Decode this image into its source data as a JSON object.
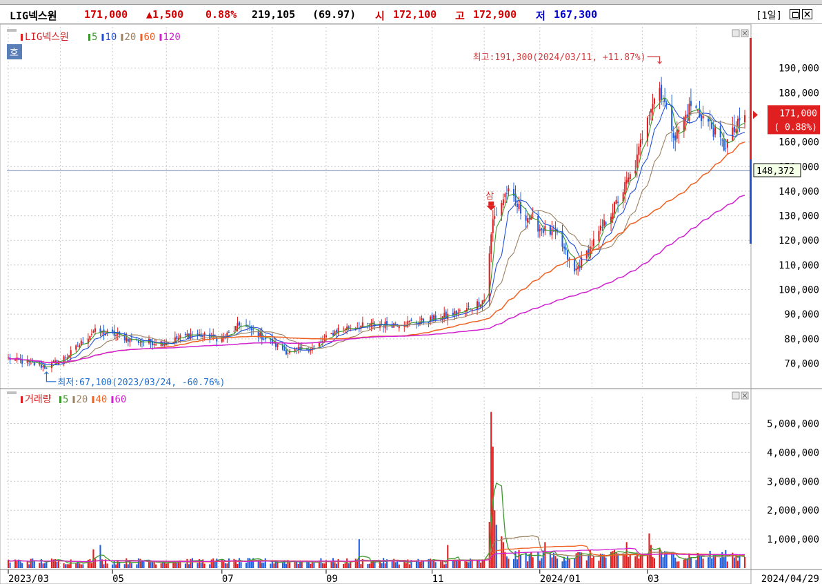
{
  "header": {
    "name": "LIG넥스원",
    "price": "171,000",
    "change": "▲1,500",
    "change_pct": "0.88%",
    "volume": "219,105",
    "volume_ratio": "(69.97)",
    "open_label": "시",
    "open": "172,100",
    "high_label": "고",
    "high": "172,900",
    "low_label": "저",
    "low": "167,300",
    "period": "[1일]"
  },
  "legend_price": {
    "name": "LIG넥스원",
    "ma": [
      {
        "label": "5",
        "color": "#3a9a2a"
      },
      {
        "label": "10",
        "color": "#1f4fd8"
      },
      {
        "label": "20",
        "color": "#9c8060"
      },
      {
        "label": "60",
        "color": "#f06020"
      },
      {
        "label": "120",
        "color": "#d020d0"
      }
    ]
  },
  "legend_volume": {
    "name": "거래량",
    "ma": [
      {
        "label": "5",
        "color": "#3a9a2a"
      },
      {
        "label": "20",
        "color": "#9c8060"
      },
      {
        "label": "40",
        "color": "#f06020"
      },
      {
        "label": "60",
        "color": "#d020d0"
      }
    ]
  },
  "badge": "호",
  "sell_marker": "삼",
  "chart_data": {
    "type": "candlestick",
    "x_start": "2023/03",
    "x_end": "2024/04/29",
    "x_ticks": [
      "2023/03",
      "05",
      "07",
      "09",
      "11",
      "2024/01",
      "03",
      "2024/04/29"
    ],
    "price_axis": {
      "ylim": [
        62000,
        200000
      ],
      "ticks": [
        "70,000",
        "80,000",
        "90,000",
        "100,000",
        "110,000",
        "120,000",
        "130,000",
        "140,000",
        "150,000",
        "160,000",
        "170,000",
        "180,000",
        "190,000"
      ],
      "tick_values": [
        70000,
        80000,
        90000,
        100000,
        110000,
        120000,
        130000,
        140000,
        150000,
        160000,
        170000,
        180000,
        190000
      ]
    },
    "volume_axis": {
      "ylim": [
        0,
        5800000
      ],
      "ticks": [
        "1,000,000",
        "2,000,000",
        "3,000,000",
        "4,000,000",
        "5,000,000"
      ],
      "tick_values": [
        1000000,
        2000000,
        3000000,
        4000000,
        5000000
      ]
    },
    "price_anchors": [
      [
        "2023-03-02",
        72000
      ],
      [
        "2023-03-24",
        68500
      ],
      [
        "2023-04-05",
        73000
      ],
      [
        "2023-04-20",
        83000
      ],
      [
        "2023-05-01",
        82000
      ],
      [
        "2023-05-15",
        79000
      ],
      [
        "2023-06-01",
        78500
      ],
      [
        "2023-06-15",
        82000
      ],
      [
        "2023-07-03",
        80000
      ],
      [
        "2023-07-14",
        86000
      ],
      [
        "2023-07-28",
        80000
      ],
      [
        "2023-08-10",
        74500
      ],
      [
        "2023-08-25",
        76500
      ],
      [
        "2023-09-08",
        84000
      ],
      [
        "2023-09-25",
        85500
      ],
      [
        "2023-10-10",
        86000
      ],
      [
        "2023-10-25",
        87000
      ],
      [
        "2023-11-08",
        89000
      ],
      [
        "2023-11-20",
        91500
      ],
      [
        "2023-12-01",
        96000
      ],
      [
        "2023-12-06",
        128000
      ],
      [
        "2023-12-14",
        140000
      ],
      [
        "2023-12-22",
        132000
      ],
      [
        "2024-01-02",
        125000
      ],
      [
        "2024-01-12",
        122000
      ],
      [
        "2024-01-22",
        107000
      ],
      [
        "2024-02-01",
        118000
      ],
      [
        "2024-02-15",
        135000
      ],
      [
        "2024-02-26",
        150000
      ],
      [
        "2024-03-04",
        172000
      ],
      [
        "2024-03-11",
        182000
      ],
      [
        "2024-03-20",
        162000
      ],
      [
        "2024-03-29",
        175000
      ],
      [
        "2024-04-08",
        168000
      ],
      [
        "2024-04-17",
        158000
      ],
      [
        "2024-04-29",
        171000
      ]
    ],
    "high": {
      "label": "최고:191,300(2024/03/11, +11.87%)",
      "date": "2024-03-11",
      "value": 191300
    },
    "low": {
      "label": "최저:67,100(2023/03/24, -60.76%)",
      "date": "2023-03-24",
      "value": 67100
    },
    "current": {
      "value": 171000,
      "label": "171,000",
      "pct_label": "( 0.88%)"
    },
    "crosshair": {
      "value": 148372,
      "label": "148,372"
    },
    "volume_baseline": 250000,
    "volume_spikes": [
      [
        "2023-04-20",
        650000
      ],
      [
        "2023-04-24",
        800000
      ],
      [
        "2023-09-20",
        1000000
      ],
      [
        "2023-11-10",
        800000
      ],
      [
        "2023-12-04",
        1600000
      ],
      [
        "2023-12-05",
        5400000
      ],
      [
        "2023-12-06",
        4200000
      ],
      [
        "2023-12-07",
        2000000
      ],
      [
        "2023-12-08",
        1500000
      ],
      [
        "2023-12-11",
        1100000
      ],
      [
        "2023-12-12",
        900000
      ],
      [
        "2024-01-05",
        900000
      ],
      [
        "2024-02-21",
        900000
      ],
      [
        "2024-03-05",
        1200000
      ],
      [
        "2024-03-06",
        800000
      ],
      [
        "2024-03-11",
        700000
      ]
    ]
  }
}
